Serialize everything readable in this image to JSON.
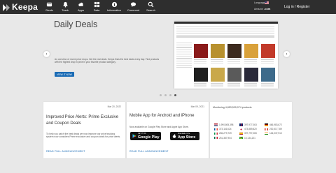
{
  "header": {
    "logo_text": "Keepa",
    "nav": [
      {
        "label": "Deals",
        "icon": "deals-icon"
      },
      {
        "label": "Track",
        "icon": "bell-icon"
      },
      {
        "label": "Apps",
        "icon": "cloud-icon"
      },
      {
        "label": "Data",
        "icon": "grid-icon"
      },
      {
        "label": "Information",
        "icon": "info-icon"
      },
      {
        "label": "Comment",
        "icon": "chat-icon"
      },
      {
        "label": "Search",
        "icon": "search-icon"
      }
    ],
    "language_label": "Language",
    "amazon_label": "Amazon",
    "amazon_domain": ".com",
    "login_label": "Log in / Register"
  },
  "hero": {
    "title": "Daily Deals",
    "description": "An overview of recent price drops. Get the real deals. Keepa finds the best deals every day. Find products with the highest drop in price in your favorite product category.",
    "button_label": "VIEW IT NOW",
    "prev_glyph": "‹",
    "next_glyph": "›",
    "slides_total": 4,
    "active_slide": 4
  },
  "cards": [
    {
      "date": "Mar 20, 2022",
      "title": "Improved Price Alerts: Prime Exclusive and Coupon Deals",
      "text": "To help you catch the best deals we now improve our price tracking system now considers Prime exclusive and coupon deals for price alerts.",
      "link": "READ FULL ANNOUNCEMENT"
    },
    {
      "date": "Mar 09, 2021",
      "title": "Mobile App for Android and iPhone",
      "text": "Now available on Google Play Store and Apple App Store.",
      "link": "READ FULL ANNOUNCEMENT",
      "google_small": "GET IT ON",
      "google_big": "Google Play",
      "apple_small": "Download on the",
      "apple_big": "App Store"
    }
  ],
  "monitoring": {
    "title": "Monitoring 4,853,539,074 products",
    "entries": [
      {
        "value": "1,990,805,398",
        "country": "US"
      },
      {
        "value": "397,977,063",
        "country": "UK"
      },
      {
        "value": "466,983,672",
        "country": "DE"
      },
      {
        "value": "373,116,624",
        "country": "FR"
      },
      {
        "value": "473,889,820",
        "country": "JP"
      },
      {
        "value": "230,517,789",
        "country": "CA"
      },
      {
        "value": "266,279,739",
        "country": "IT"
      },
      {
        "value": "397,797,265",
        "country": "ES"
      },
      {
        "value": "146,037,910",
        "country": "IN"
      },
      {
        "value": "251,387,904",
        "country": "MX"
      },
      {
        "value": "10,134,221",
        "country": "BR"
      }
    ]
  },
  "colors": {
    "topbar": "#2e2e2e",
    "accent_blue": "#1a6bb5",
    "background": "#e8e8e8"
  }
}
